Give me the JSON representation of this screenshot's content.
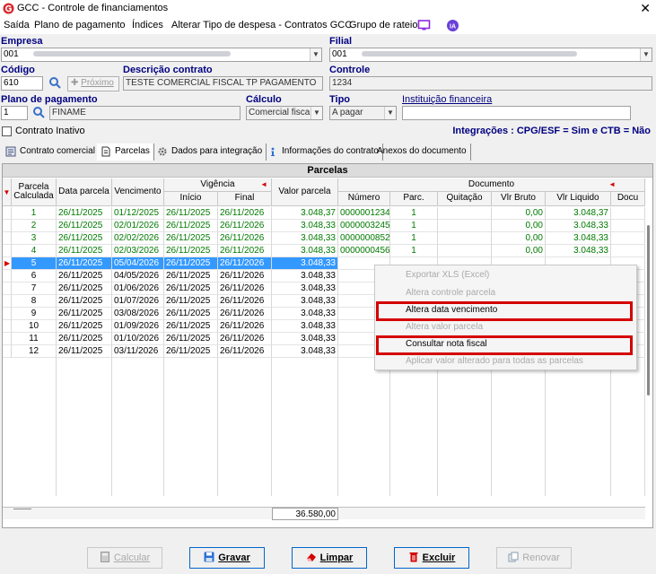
{
  "window": {
    "title": "GCC - Controle de financiamentos"
  },
  "menu": {
    "items": [
      "Saída",
      "Plano de pagamento",
      "Índices",
      "Alterar Tipo de despesa - Contratos GCC",
      "Grupo de rateio"
    ]
  },
  "form": {
    "empresa_label": "Empresa",
    "empresa_value": "001",
    "filial_label": "Filial",
    "filial_value": "001",
    "codigo_label": "Código",
    "codigo_value": "610",
    "proximo_label": "Próximo",
    "descricao_label": "Descrição contrato",
    "descricao_value": "TESTE COMERCIAL FISCAL TP PAGAMENTO",
    "controle_label": "Controle",
    "controle_value": "1234",
    "plano_label": "Plano de pagamento",
    "plano_code": "1",
    "plano_value": "FINAME",
    "calculo_label": "Cálculo",
    "calculo_value": "Comercial fiscal",
    "tipo_label": "Tipo",
    "tipo_value": "A pagar",
    "instituicao_label": "Instituição financeira",
    "instituicao_value": "",
    "inativo_label": "Contrato Inativo",
    "integracoes": "Integrações : CPG/ESF = Sim e CTB = Não"
  },
  "tabs": [
    {
      "label": "Contrato comercial",
      "icon": "contract-icon"
    },
    {
      "label": "Parcelas",
      "icon": "document-icon"
    },
    {
      "label": "Dados para integração",
      "icon": "gears-icon"
    },
    {
      "label": "Informações do contrato",
      "icon": "info-icon"
    },
    {
      "label": "Anexos do documento",
      "icon": ""
    }
  ],
  "grid": {
    "title": "Parcelas",
    "group_vigencia": "Vigência",
    "group_documento": "Documento",
    "headers": {
      "parcela": "Parcela Calculada",
      "data_parcela": "Data parcela",
      "vencimento": "Vencimento",
      "inicio": "Início",
      "final": "Final",
      "valor": "Valor parcela",
      "numero": "Número",
      "parc": "Parc.",
      "quitacao": "Quitação",
      "vlr_bruto": "Vlr Bruto",
      "vlr_liquido": "Vlr Liquido",
      "docu": "Docu"
    },
    "rows": [
      {
        "parcela": "1",
        "data": "26/11/2025",
        "venc": "01/12/2025",
        "inicio": "26/11/2025",
        "final": "26/11/2026",
        "valor": "3.048,37",
        "numero": "0000001234",
        "parc": "1",
        "bruto": "0,00",
        "liquido": "3.048,37",
        "state": "green"
      },
      {
        "parcela": "2",
        "data": "26/11/2025",
        "venc": "02/01/2026",
        "inicio": "26/11/2025",
        "final": "26/11/2026",
        "valor": "3.048,33",
        "numero": "0000003245",
        "parc": "1",
        "bruto": "0,00",
        "liquido": "3.048,33",
        "state": "green"
      },
      {
        "parcela": "3",
        "data": "26/11/2025",
        "venc": "02/02/2026",
        "inicio": "26/11/2025",
        "final": "26/11/2026",
        "valor": "3.048,33",
        "numero": "0000000852",
        "parc": "1",
        "bruto": "0,00",
        "liquido": "3.048,33",
        "state": "green"
      },
      {
        "parcela": "4",
        "data": "26/11/2025",
        "venc": "02/03/2026",
        "inicio": "26/11/2025",
        "final": "26/11/2026",
        "valor": "3.048,33",
        "numero": "0000000456",
        "parc": "1",
        "bruto": "0,00",
        "liquido": "3.048,33",
        "state": "green"
      },
      {
        "parcela": "5",
        "data": "26/11/2025",
        "venc": "05/04/2026",
        "inicio": "26/11/2025",
        "final": "26/11/2026",
        "valor": "3.048,33",
        "numero": "",
        "parc": "",
        "bruto": "",
        "liquido": "",
        "state": "selected"
      },
      {
        "parcela": "6",
        "data": "26/11/2025",
        "venc": "04/05/2026",
        "inicio": "26/11/2025",
        "final": "26/11/2026",
        "valor": "3.048,33",
        "numero": "",
        "parc": "",
        "bruto": "",
        "liquido": "",
        "state": "normal"
      },
      {
        "parcela": "7",
        "data": "26/11/2025",
        "venc": "01/06/2026",
        "inicio": "26/11/2025",
        "final": "26/11/2026",
        "valor": "3.048,33",
        "numero": "",
        "parc": "",
        "bruto": "",
        "liquido": "",
        "state": "normal"
      },
      {
        "parcela": "8",
        "data": "26/11/2025",
        "venc": "01/07/2026",
        "inicio": "26/11/2025",
        "final": "26/11/2026",
        "valor": "3.048,33",
        "numero": "",
        "parc": "",
        "bruto": "",
        "liquido": "",
        "state": "normal"
      },
      {
        "parcela": "9",
        "data": "26/11/2025",
        "venc": "03/08/2026",
        "inicio": "26/11/2025",
        "final": "26/11/2026",
        "valor": "3.048,33",
        "numero": "",
        "parc": "",
        "bruto": "",
        "liquido": "",
        "state": "normal"
      },
      {
        "parcela": "10",
        "data": "26/11/2025",
        "venc": "01/09/2026",
        "inicio": "26/11/2025",
        "final": "26/11/2026",
        "valor": "3.048,33",
        "numero": "",
        "parc": "",
        "bruto": "",
        "liquido": "",
        "state": "normal"
      },
      {
        "parcela": "11",
        "data": "26/11/2025",
        "venc": "01/10/2026",
        "inicio": "26/11/2025",
        "final": "26/11/2026",
        "valor": "3.048,33",
        "numero": "",
        "parc": "",
        "bruto": "",
        "liquido": "",
        "state": "normal"
      },
      {
        "parcela": "12",
        "data": "26/11/2025",
        "venc": "03/11/2026",
        "inicio": "26/11/2025",
        "final": "26/11/2026",
        "valor": "3.048,33",
        "numero": "",
        "parc": "",
        "bruto": "",
        "liquido": "",
        "state": "normal"
      }
    ],
    "total": "36.580,00"
  },
  "context_menu": {
    "items": [
      {
        "label": "Exportar XLS (Excel)",
        "enabled": false,
        "highlight": false
      },
      {
        "label": "Altera controle parcela",
        "enabled": false,
        "highlight": false
      },
      {
        "label": "Altera data vencimento",
        "enabled": true,
        "highlight": true
      },
      {
        "label": "Altera valor parcela",
        "enabled": false,
        "highlight": false
      },
      {
        "label": "Consultar nota fiscal",
        "enabled": true,
        "highlight": true
      },
      {
        "label": "Aplicar valor alterado para todas as parcelas",
        "enabled": false,
        "highlight": false
      }
    ]
  },
  "buttons": {
    "calcular": "Calcular",
    "gravar": "Gravar",
    "limpar": "Limpar",
    "excluir": "Excluir",
    "renovar": "Renovar"
  },
  "colors": {
    "accent": "#000080",
    "selection": "#3399ff",
    "paid_text": "#007a00",
    "highlight_box": "#d40000"
  }
}
